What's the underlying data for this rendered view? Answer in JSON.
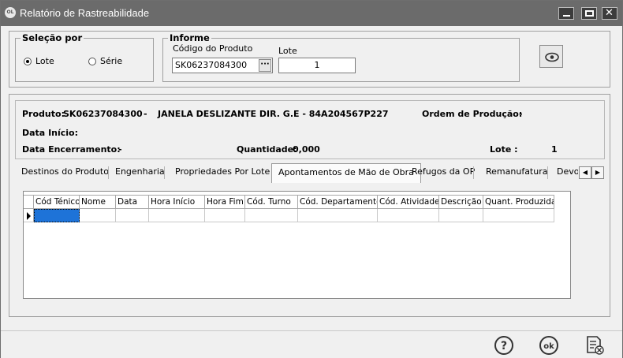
{
  "window": {
    "title": "Relatório de Rastreabilidade",
    "app_icon_text": "OL"
  },
  "selection": {
    "legend": "Seleção por",
    "options": [
      {
        "label": "Lote",
        "selected": true
      },
      {
        "label": "Série",
        "selected": false
      }
    ]
  },
  "informe": {
    "legend": "Informe",
    "product_code_label": "Código do Produto",
    "product_code_value": "SK06237084300",
    "lot_label": "Lote",
    "lot_value": "1",
    "browse_button": "···"
  },
  "info": {
    "product_label": "Produto:",
    "product_code": "SK06237084300",
    "dash": "-",
    "product_description": "JANELA DESLIZANTE DIR. G.E - 84A204567P227",
    "production_order_label": "Ordem de Produção:",
    "production_order_value": "-",
    "start_date_label": "Data Início:",
    "end_date_label": "Data Encerramento:",
    "end_date_value": "-",
    "quantity_label": "Quantidade:",
    "quantity_value": "0,000",
    "lot_label": "Lote :",
    "lot_value": "1"
  },
  "tabs": [
    "Destinos do Produto",
    "Engenharia",
    "Propriedades Por Lote",
    "Apontamentos de Mão de Obra",
    "Refugos da OP",
    "Remanufatura",
    "Devo"
  ],
  "active_tab": "Apontamentos de Mão de Obra",
  "grid": {
    "columns": [
      "Cód Ténico",
      "Nome",
      "Data",
      "Hora Início",
      "Hora Fim",
      "Cód. Turno",
      "Cód. Departamento",
      "Cód. Atividade",
      "Descrição",
      "Quant. Produzida"
    ],
    "rows": [
      [
        "",
        "",
        "",
        "",
        "",
        "",
        "",
        "",
        "",
        ""
      ]
    ]
  },
  "footer": {
    "icons": [
      "help-icon",
      "ok-icon",
      "close-report-icon"
    ],
    "ok_text": "ok"
  },
  "colors": {
    "titlebar": "#6b6b6b",
    "selected_cell": "#1e73d8",
    "background": "#f0f0f0"
  }
}
